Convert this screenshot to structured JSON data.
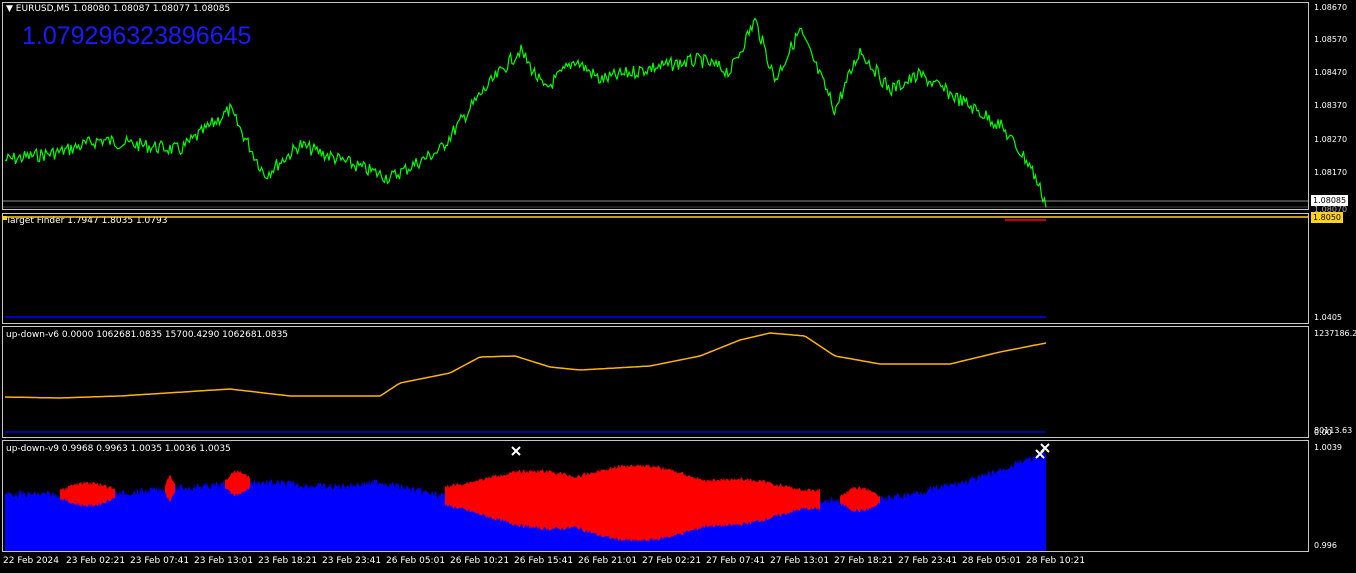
{
  "main": {
    "header": "EURUSD,M5  1.08080 1.08087 1.08077 1.08085",
    "big_value": "1.079296323896645",
    "price_ticks": [
      "1.08670",
      "1.08570",
      "1.08470",
      "1.08370",
      "1.08270",
      "1.08170",
      "1.08085",
      "1.08070"
    ],
    "current_price": "1.08085",
    "colors": {
      "line": "#00ff00",
      "big_value": "#1a1aff"
    }
  },
  "target_finder": {
    "header": "Target Finder 1.7947 1.8035 1.0793",
    "ticks": [
      "1.8050",
      "1.0405"
    ],
    "colors": {
      "line": "#ffd21e",
      "blue": "#0000ff",
      "red": "#ff0000"
    }
  },
  "up_down_v6": {
    "header": "up-down-v6 0.0000 1062681.0835 15700.4290 1062681.0835",
    "ticks": [
      "1237186.2",
      "80113.63",
      "0.00"
    ],
    "colors": {
      "line": "#ffb400",
      "blue": "#0000ff"
    }
  },
  "up_down_v9": {
    "header": "up-down-v9 0.9968 0.9963 1.0035 1.0036 1.0035",
    "ticks": [
      "1.0039",
      "0.996"
    ],
    "colors": {
      "blue": "#0000ff",
      "red": "#ff0000"
    }
  },
  "time_axis": [
    "22 Feb 2024",
    "23 Feb 02:21",
    "23 Feb 07:41",
    "23 Feb 13:01",
    "23 Feb 18:21",
    "23 Feb 23:41",
    "26 Feb 05:01",
    "26 Feb 10:21",
    "26 Feb 15:41",
    "26 Feb 21:01",
    "27 Feb 02:21",
    "27 Feb 07:41",
    "27 Feb 13:01",
    "27 Feb 18:21",
    "27 Feb 23:41",
    "28 Feb 05:01",
    "28 Feb 10:21"
  ]
}
